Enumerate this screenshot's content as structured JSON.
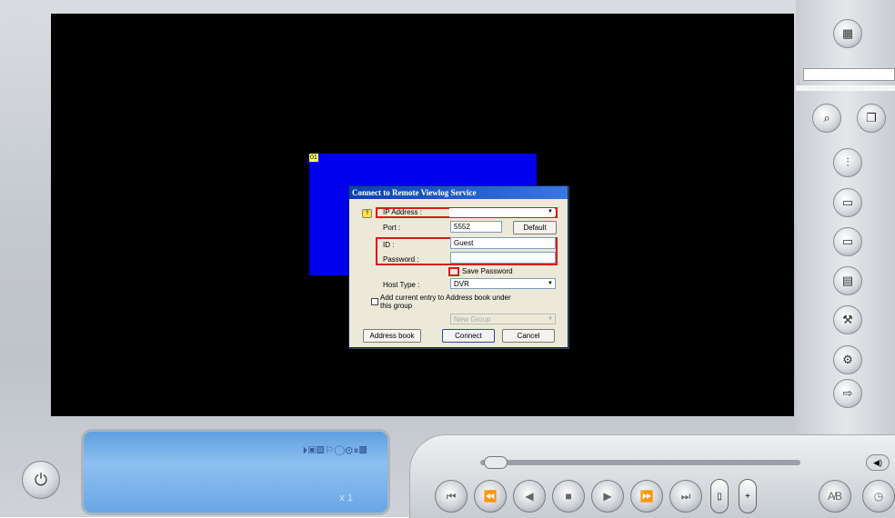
{
  "channel": {
    "label": "01"
  },
  "dialog": {
    "title": "Connect to Remote Viewlog Service",
    "ip_label": "IP Address :",
    "ip_value": "",
    "port_label": "Port :",
    "port_value": "5552",
    "default_label": "Default",
    "id_label": "ID :",
    "id_value": "Guest",
    "password_label": "Password :",
    "password_value": "",
    "save_password_label": "Save Password",
    "host_type_label": "Host Type :",
    "host_type_value": "DVR",
    "add_entry_line1": "Add current entry to Address book under",
    "add_entry_line2": "this group",
    "group_value": "New Group",
    "address_book_label": "Address book",
    "connect_label": "Connect",
    "cancel_label": "Cancel"
  },
  "lcd": {
    "icons": "⏵▣▤⚐◯⚙⏸▦",
    "speed": "x 1"
  },
  "colors": {
    "screen": "#000000",
    "channel": "#0000ee",
    "highlight": "#d71c1c"
  },
  "icons": {
    "side": [
      "camera-icon",
      "search-icon",
      "copy-icon",
      "equalizer-icon",
      "save-avi-icon",
      "save-dsp-icon",
      "print-icon",
      "tools-icon",
      "settings-icon",
      "export-icon"
    ],
    "playback": [
      "first-icon",
      "prev-icon",
      "rewind-icon",
      "stop-icon",
      "play-icon",
      "forward-icon",
      "last-icon"
    ]
  }
}
